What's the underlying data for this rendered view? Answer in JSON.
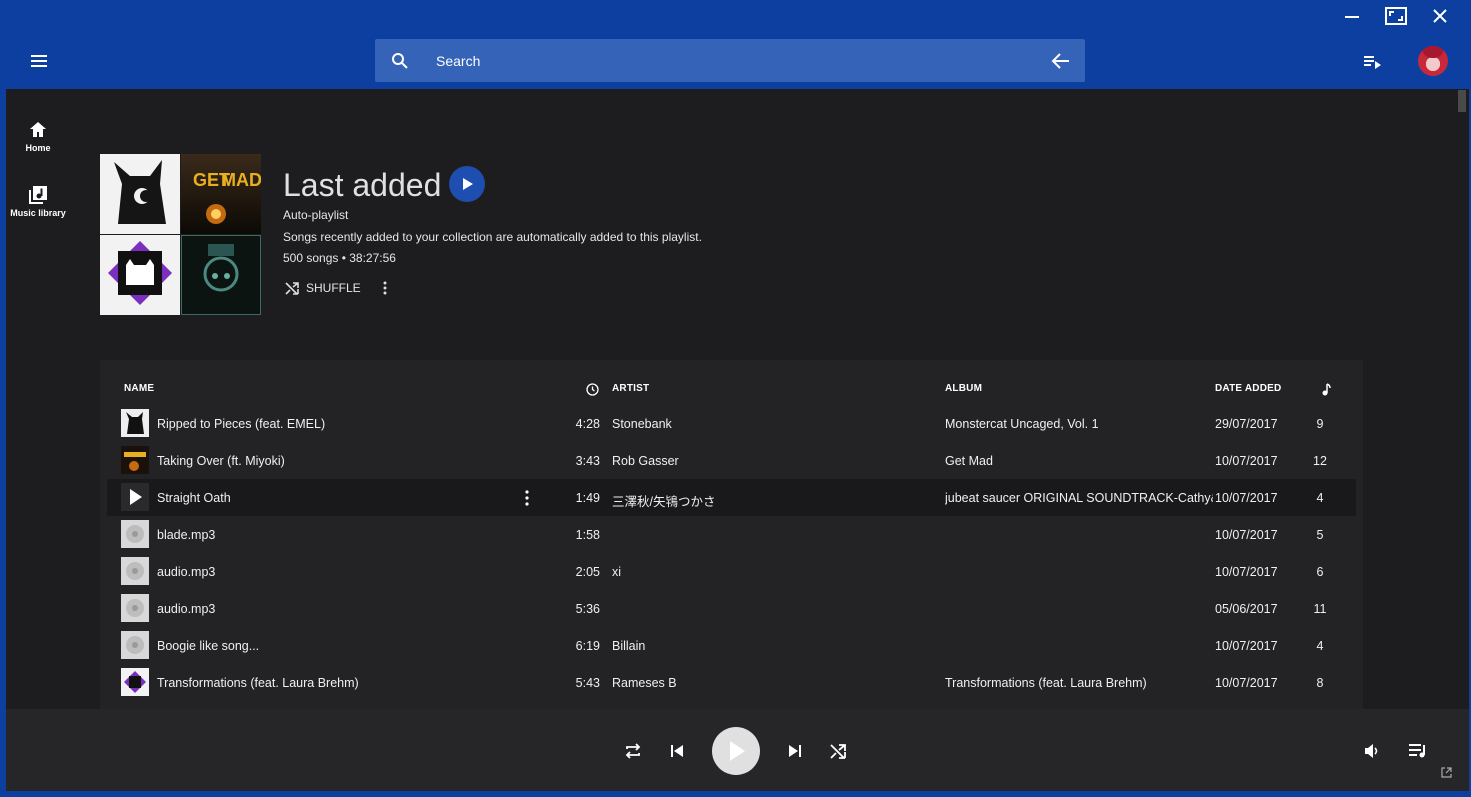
{
  "window": {
    "controls": [
      "minimize-icon",
      "maximize-icon",
      "close-icon"
    ]
  },
  "header": {
    "search": {
      "placeholder": "Search"
    },
    "icons": [
      "menu-icon",
      "search-icon",
      "arrow-back-icon",
      "queue-music-icon",
      "avatar"
    ]
  },
  "sidebar": {
    "items": [
      {
        "label": "Home",
        "icon": "home-icon"
      },
      {
        "label": "Music library",
        "icon": "library-music-icon"
      }
    ]
  },
  "playlist": {
    "title": "Last added",
    "type": "Auto-playlist",
    "description": "Songs recently added to your collection are automatically added to this playlist.",
    "stats": "500 songs • 38:27:56",
    "shuffle_label": "SHUFFLE"
  },
  "table": {
    "headers": {
      "name": "NAME",
      "artist": "ARTIST",
      "album": "ALBUM",
      "date": "DATE ADDED"
    },
    "rows": [
      {
        "name": "Ripped to Pieces (feat. EMEL)",
        "time": "4:28",
        "artist": "Stonebank",
        "album": "Monstercat Uncaged, Vol. 1",
        "date": "29/07/2017",
        "plays": "9",
        "thumb": "dark-cat"
      },
      {
        "name": "Taking Over (ft. Miyoki)",
        "time": "3:43",
        "artist": "Rob Gasser",
        "album": "Get Mad",
        "date": "10/07/2017",
        "plays": "12",
        "thumb": "getmad"
      },
      {
        "name": "Straight Oath",
        "time": "1:49",
        "artist": "三澤秋/矢鴇つかさ",
        "album": "jubeat saucer ORIGINAL SOUNDTRACK-Cathy&...",
        "date": "10/07/2017",
        "plays": "4",
        "thumb": "play"
      },
      {
        "name": "blade.mp3",
        "time": "1:58",
        "artist": "",
        "album": "",
        "date": "10/07/2017",
        "plays": "5",
        "thumb": "disc"
      },
      {
        "name": "audio.mp3",
        "time": "2:05",
        "artist": "xi",
        "album": "",
        "date": "10/07/2017",
        "plays": "6",
        "thumb": "disc"
      },
      {
        "name": "audio.mp3",
        "time": "5:36",
        "artist": "",
        "album": "",
        "date": "05/06/2017",
        "plays": "11",
        "thumb": "disc"
      },
      {
        "name": "Boogie like song...",
        "time": "6:19",
        "artist": "Billain",
        "album": "",
        "date": "10/07/2017",
        "plays": "4",
        "thumb": "disc"
      },
      {
        "name": "Transformations (feat. Laura Brehm)",
        "time": "5:43",
        "artist": "Rameses B",
        "album": "Transformations (feat. Laura Brehm)",
        "date": "10/07/2017",
        "plays": "8",
        "thumb": "purple"
      }
    ]
  },
  "player": {
    "icons": [
      "repeat-icon",
      "skip-previous-icon",
      "play-icon",
      "skip-next-icon",
      "shuffle-icon",
      "volume-icon",
      "queue-icon",
      "popout-icon"
    ]
  },
  "colors": {
    "accent": "#0d3fa0",
    "search_bg": "#3563b8",
    "play_button": "#1e4fb0",
    "content_bg": "#1d1d1f",
    "table_bg": "#232325"
  }
}
